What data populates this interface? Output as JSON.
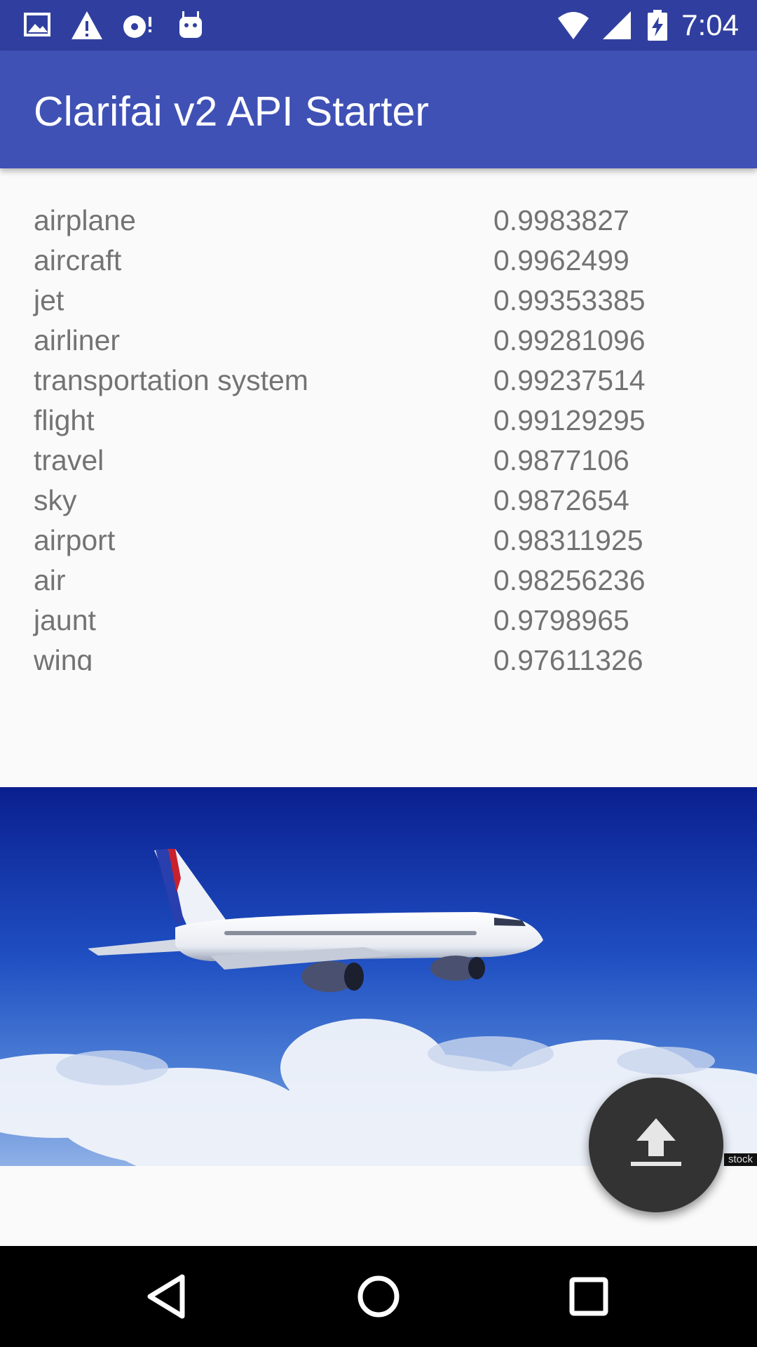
{
  "status_bar": {
    "time": "7:04",
    "left_icons": [
      "gallery-notification-icon",
      "warning-icon",
      "disc-alert-icon",
      "android-icon"
    ],
    "right_icons": [
      "wifi-icon",
      "cell-signal-icon",
      "battery-charging-icon"
    ]
  },
  "app_bar": {
    "title": "Clarifai v2 API Starter",
    "color": "#3f51b5"
  },
  "results": [
    {
      "label": "airplane",
      "score": "0.9983827"
    },
    {
      "label": "aircraft",
      "score": "0.9962499"
    },
    {
      "label": "jet",
      "score": "0.99353385"
    },
    {
      "label": "airliner",
      "score": "0.99281096"
    },
    {
      "label": "transportation system",
      "score": "0.99237514"
    },
    {
      "label": "flight",
      "score": "0.99129295"
    },
    {
      "label": "travel",
      "score": "0.9877106"
    },
    {
      "label": "sky",
      "score": "0.9872654"
    },
    {
      "label": "airport",
      "score": "0.98311925"
    },
    {
      "label": "air",
      "score": "0.98256236"
    },
    {
      "label": "jaunt",
      "score": "0.9798965"
    },
    {
      "label": "wing",
      "score": "0.97611326"
    }
  ],
  "image": {
    "watermark": "stock"
  },
  "fab": {
    "icon": "upload-icon"
  },
  "nav_bar": {
    "buttons": [
      "back-icon",
      "home-icon",
      "recents-icon"
    ]
  }
}
